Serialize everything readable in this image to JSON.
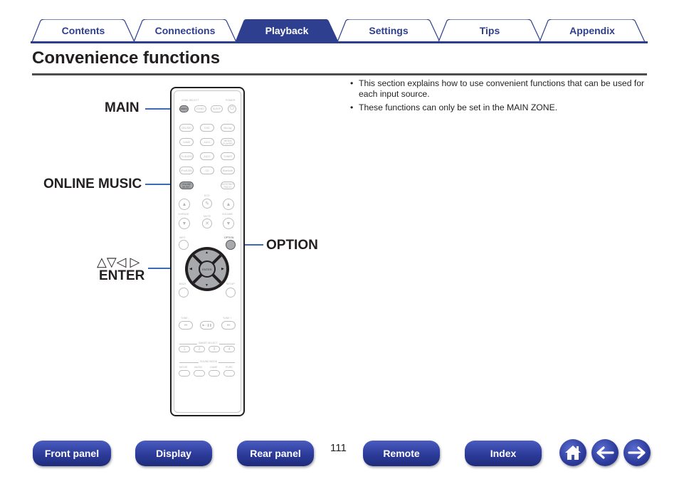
{
  "tabs": [
    {
      "label": "Contents",
      "active": false
    },
    {
      "label": "Connections",
      "active": false
    },
    {
      "label": "Playback",
      "active": true
    },
    {
      "label": "Settings",
      "active": false
    },
    {
      "label": "Tips",
      "active": false
    },
    {
      "label": "Appendix",
      "active": false
    }
  ],
  "page": {
    "title": "Convenience functions",
    "bullets": [
      "This section explains how to use convenient functions that can be used for each input source.",
      "These functions can only be set in the MAIN ZONE."
    ]
  },
  "callouts": {
    "main": "MAIN",
    "online_music": "ONLINE MUSIC",
    "arrows": "△▽◁ ▷",
    "enter": "ENTER",
    "option": "OPTION"
  },
  "remote": {
    "zone_select": "ZONE SELECT",
    "power": "POWER",
    "row_zone": [
      "MAIN",
      "ZONE2",
      "SLEEP"
    ],
    "power_icon": "⏻",
    "inputs": [
      [
        "CBL/SAT",
        "DVD",
        "Blu-ray"
      ],
      [
        "GAME",
        "AUX1",
        "MEDIA PLAYER"
      ],
      [
        "TV AUDIO",
        "AUX2",
        "TUNER"
      ],
      [
        "iPod/USB",
        "CD",
        "Bluetooth"
      ],
      [
        "ONLINE MUSIC",
        "",
        "INTERNET RADIO"
      ]
    ],
    "eco": "ECO",
    "ch_page": "CH/PAGE",
    "mute": "MUTE",
    "volume": "VOLUME",
    "info": "INFO",
    "option": "OPTION",
    "enter": "ENTER",
    "back": "BACK",
    "setup": "SETUP",
    "tune_minus": "TUNE -",
    "tune_plus": "TUNE +",
    "transport": [
      "⏮",
      "▶ / ❚❚",
      "⏭"
    ],
    "smart_select": "SMART SELECT",
    "smart_buttons": [
      "1",
      "2",
      "3",
      "4"
    ],
    "sound_mode": "SOUND MODE",
    "sound_buttons": [
      "MOVIE",
      "MUSIC",
      "GAME",
      "PURE"
    ]
  },
  "footer": {
    "buttons": [
      "Front panel",
      "Display",
      "Rear panel",
      "Remote",
      "Index"
    ],
    "page_number": "111",
    "icons": [
      "home-icon",
      "back-arrow-icon",
      "forward-arrow-icon"
    ]
  },
  "colors": {
    "accent": "#2e3f8f",
    "callout_line": "#3b6bb5"
  }
}
